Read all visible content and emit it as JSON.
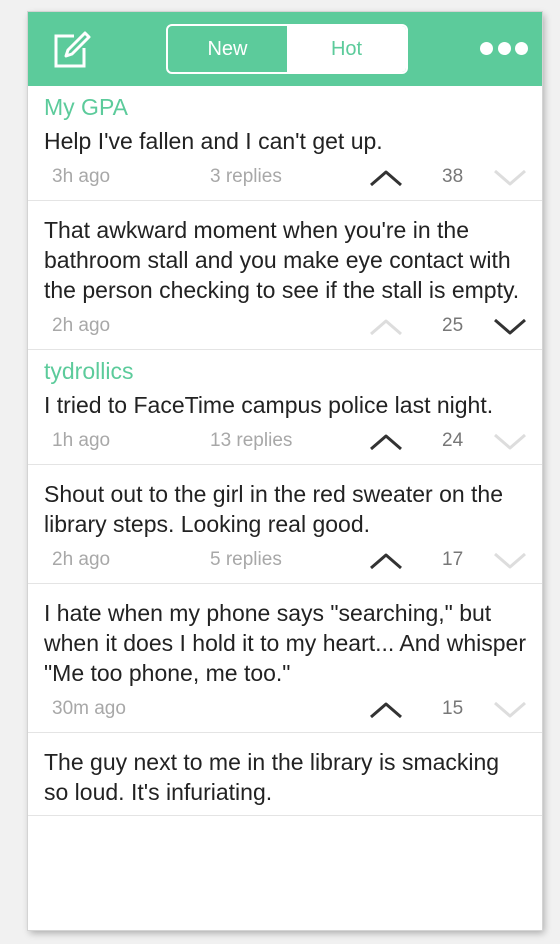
{
  "header": {
    "tabs": [
      {
        "label": "New",
        "active": false
      },
      {
        "label": "Hot",
        "active": true
      }
    ],
    "icons": {
      "compose": "compose-icon",
      "more": "more-options-icon"
    },
    "accent_color": "#5ccb9b"
  },
  "posts": [
    {
      "author": "My GPA",
      "text": "Help I've fallen and I can't get up.",
      "time": "3h ago",
      "replies": "3 replies",
      "score": "38",
      "vote": "up"
    },
    {
      "author": "",
      "text": "That awkward moment when you're in the bathroom stall and you make eye contact with the person checking to see if the stall is empty.",
      "time": "2h ago",
      "replies": "",
      "score": "25",
      "vote": "down"
    },
    {
      "author": "tydrollics",
      "text": "I tried to FaceTime campus police last night.",
      "time": "1h ago",
      "replies": "13 replies",
      "score": "24",
      "vote": "up"
    },
    {
      "author": "",
      "text": "Shout out to the girl in the red sweater on the library steps. Looking real good.",
      "time": "2h ago",
      "replies": "5 replies",
      "score": "17",
      "vote": "up"
    },
    {
      "author": "",
      "text": "I hate when my phone says \"searching,\" but when it does I hold it to my heart... And whisper \"Me too phone, me too.\"",
      "time": "30m ago",
      "replies": "",
      "score": "15",
      "vote": "up"
    },
    {
      "author": "",
      "text": "The guy next to me in the library is smacking so loud. It's infuriating.",
      "time": "",
      "replies": "",
      "score": "",
      "vote": ""
    }
  ]
}
